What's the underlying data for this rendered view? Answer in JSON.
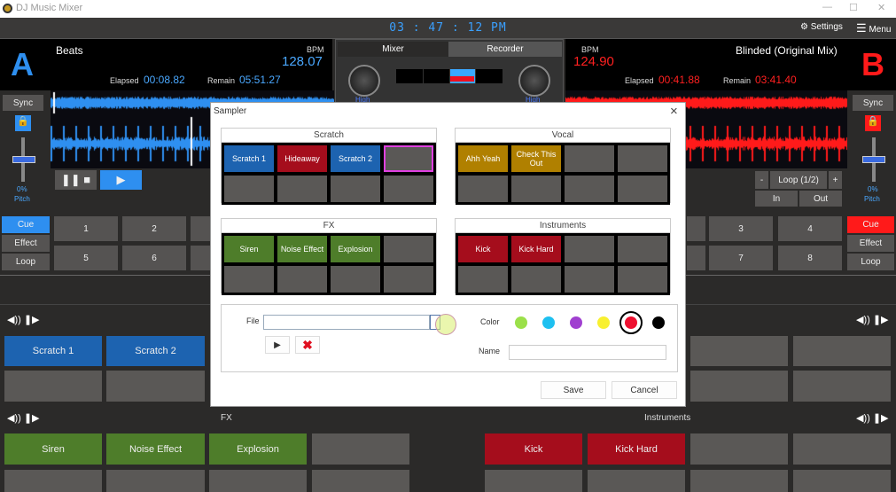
{
  "app": {
    "title": "DJ Music Mixer",
    "clock": "03 : 47 : 12 PM",
    "settings": "Settings",
    "menu": "Menu"
  },
  "colors": {
    "deck_a": "#2e8ff0",
    "deck_b": "#ff1a1a",
    "scratch": "#1d63b0",
    "vocal": "#b08000",
    "fx": "#4e7d2a",
    "instruments": "#a50d1c"
  },
  "deck_a": {
    "letter": "A",
    "track": "Beats",
    "bpm_label": "BPM",
    "bpm": "128.07",
    "elapsed_label": "Elapsed",
    "elapsed": "00:08.82",
    "remain_label": "Remain",
    "remain": "05:51.27",
    "sync": "Sync",
    "pitch": "0%",
    "pitch_label": "Pitch",
    "modes": [
      "Cue",
      "Effect",
      "Loop"
    ],
    "cues": [
      "1",
      "2",
      "5",
      "6"
    ]
  },
  "deck_b": {
    "letter": "B",
    "track": "Blinded (Original Mix)",
    "bpm_label": "BPM",
    "bpm": "124.90",
    "elapsed_label": "Elapsed",
    "elapsed": "00:41.88",
    "remain_label": "Remain",
    "remain": "03:41.40",
    "sync": "Sync",
    "pitch": "0%",
    "pitch_label": "Pitch",
    "modes": [
      "Cue",
      "Effect",
      "Loop"
    ],
    "cues": [
      "3",
      "4",
      "7",
      "8"
    ],
    "loop": {
      "minus": "-",
      "label": "Loop (1/2)",
      "plus": "+",
      "in": "In",
      "out": "Out"
    }
  },
  "mixer": {
    "tabs": [
      "Mixer",
      "Recorder"
    ],
    "knob_label": "High"
  },
  "bottom": {
    "fx_label": "FX",
    "instruments_label": "Instruments",
    "scratch": [
      "Scratch 1",
      "Scratch 2"
    ],
    "fx": [
      "Siren",
      "Noise Effect",
      "Explosion"
    ],
    "instruments": [
      "Kick",
      "Kick Hard"
    ]
  },
  "sampler": {
    "title": "Sampler",
    "close": "×",
    "groups": [
      {
        "name": "Scratch",
        "pads": [
          "Scratch 1",
          "Hideaway",
          "Scratch 2",
          "",
          "",
          "",
          "",
          ""
        ],
        "colors": [
          "#1d63b0",
          "#a50d1c",
          "#1d63b0",
          "",
          "",
          "",
          "",
          ""
        ]
      },
      {
        "name": "Vocal",
        "pads": [
          "Ahh Yeah",
          "Check This Out",
          "",
          "",
          "",
          "",
          "",
          ""
        ],
        "colors": [
          "#b08000",
          "#b08000",
          "",
          "",
          "",
          "",
          "",
          ""
        ]
      },
      {
        "name": "FX",
        "pads": [
          "Siren",
          "Noise Effect",
          "Explosion",
          "",
          "",
          "",
          "",
          ""
        ],
        "colors": [
          "#4e7d2a",
          "#4e7d2a",
          "#4e7d2a",
          "",
          "",
          "",
          "",
          ""
        ]
      },
      {
        "name": "Instruments",
        "pads": [
          "Kick",
          "Kick Hard",
          "",
          "",
          "",
          "",
          "",
          ""
        ],
        "colors": [
          "#a50d1c",
          "#a50d1c",
          "",
          "",
          "",
          "",
          "",
          ""
        ]
      }
    ],
    "file_label": "File",
    "file_value": "",
    "color_label": "Color",
    "name_label": "Name",
    "name_value": "",
    "color_options": [
      "#9be04a",
      "#1ec0f0",
      "#a040d0",
      "#f8f030",
      "#ee1030",
      "#000000"
    ],
    "selected_color": "#ee1030",
    "save": "Save",
    "cancel": "Cancel"
  }
}
